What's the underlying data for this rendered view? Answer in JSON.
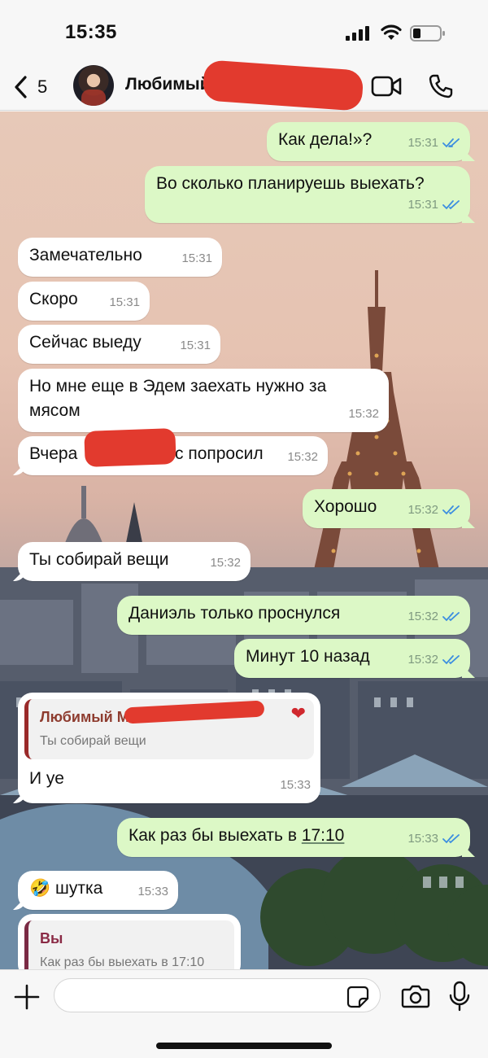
{
  "status": {
    "time": "15:35"
  },
  "header": {
    "back_count": "5",
    "contact_name": "Любимый М"
  },
  "messages": [
    {
      "text": "Как дела!»?",
      "time": "15:31"
    },
    {
      "text": "Во сколько планируешь выехать?",
      "time": "15:31"
    },
    {
      "text": "Замечательно",
      "time": "15:31"
    },
    {
      "text": "Скоро",
      "time": "15:31"
    },
    {
      "text": "Сейчас выеду",
      "time": "15:31"
    },
    {
      "text_line1": "Но мне еще в Эдем заехать нужно за",
      "text_line2": "мясом",
      "time": "15:32"
    },
    {
      "text_a": "Вчера",
      "text_b": "с попросил",
      "time": "15:32"
    },
    {
      "text": "Хорошо",
      "time": "15:32"
    },
    {
      "text": "Ты собирай вещи",
      "time": "15:32"
    },
    {
      "text": "Даниэль только проснулся",
      "time": "15:32"
    },
    {
      "text": "Минут 10 назад",
      "time": "15:32"
    },
    {
      "quote_author": "Любимый М",
      "quote_text": "Ты собирай вещи",
      "text": "И уе",
      "time": "15:33"
    },
    {
      "text_a": "Как раз бы выехать в ",
      "text_link": "17:10",
      "time": "15:33"
    },
    {
      "emoji": "🤣",
      "text": "шутка",
      "time": "15:33"
    },
    {
      "quote_author": "Вы",
      "quote_text": "Как раз бы выехать в 17:10"
    }
  ],
  "colors": {
    "outgoing": "#dcf8c6",
    "incoming": "#ffffff",
    "check": "#3b8de0",
    "redaction": "#e23a2e"
  },
  "icons": [
    "back-chevron-icon",
    "video-icon",
    "phone-icon",
    "plus-icon",
    "sticker-icon",
    "camera-icon",
    "mic-icon",
    "double-check-icon"
  ]
}
